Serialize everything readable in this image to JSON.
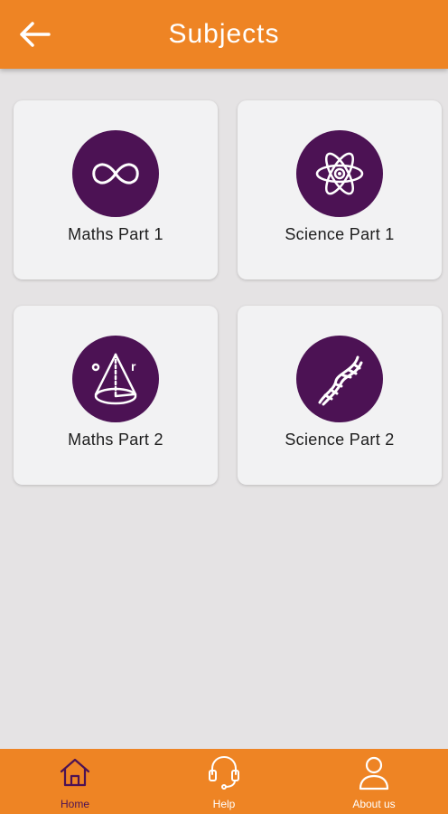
{
  "header": {
    "title": "Subjects",
    "back_icon": "arrow-left-icon"
  },
  "subjects": [
    {
      "label": "Maths Part 1",
      "icon": "infinity-icon"
    },
    {
      "label": "Science Part 1",
      "icon": "atom-icon"
    },
    {
      "label": "Maths Part 2",
      "icon": "cone-geometry-icon"
    },
    {
      "label": "Science Part 2",
      "icon": "dna-icon"
    }
  ],
  "bottom_nav": {
    "items": [
      {
        "label": "Home",
        "icon": "home-icon",
        "active": true
      },
      {
        "label": "Help",
        "icon": "headset-icon",
        "active": false
      },
      {
        "label": "About us",
        "icon": "user-icon",
        "active": false
      }
    ]
  },
  "colors": {
    "accent": "#ee8424",
    "circle": "#4c1254",
    "background": "#e5e3e4",
    "card": "#f2f2f3"
  }
}
